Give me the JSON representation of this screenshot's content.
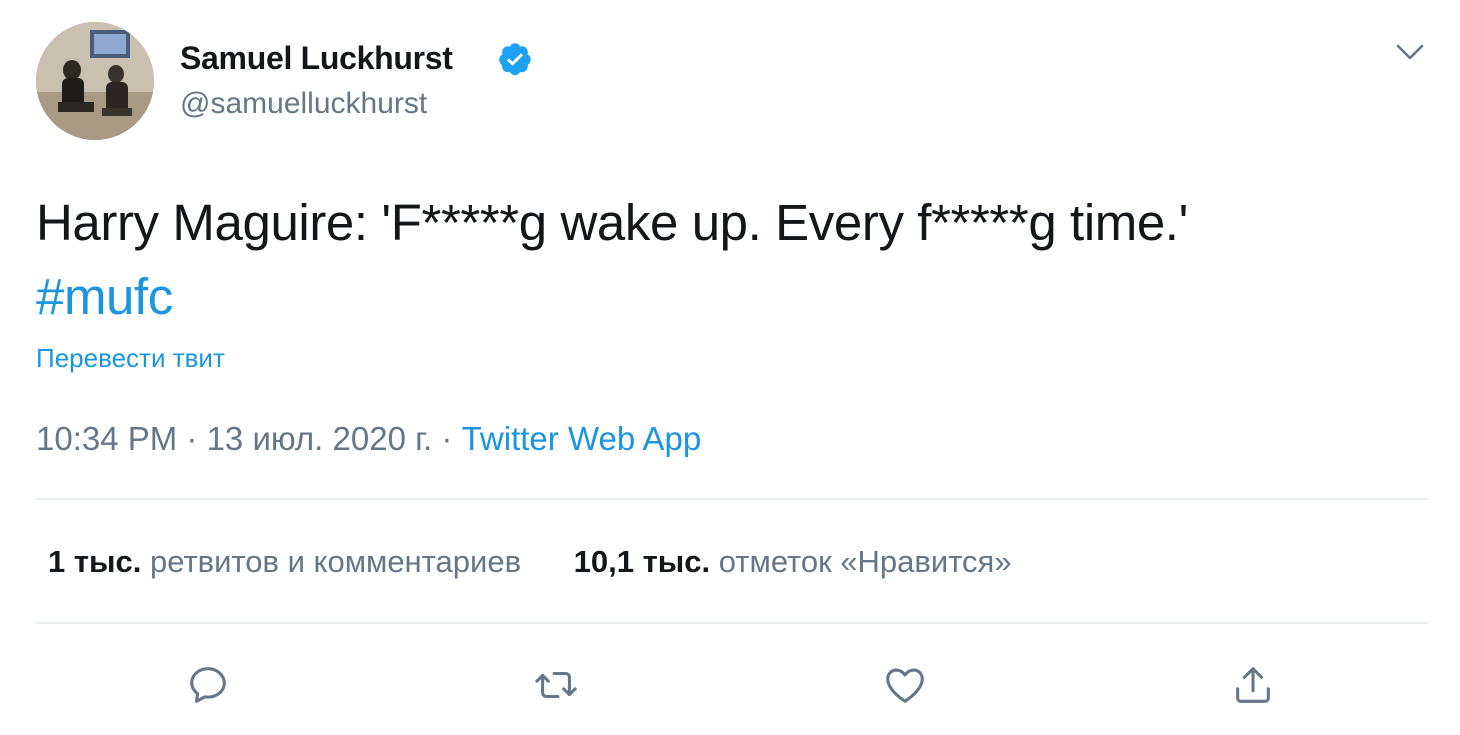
{
  "author": {
    "name": "Samuel Luckhurst",
    "handle": "@samuelluckhurst",
    "verified": true
  },
  "tweet": {
    "text": "Harry Maguire: 'F*****g wake up. Every f*****g time.'",
    "hashtag": "#mufc",
    "translate_label": "Перевести твит"
  },
  "meta": {
    "time": "10:34 PM",
    "separator": " · ",
    "date": "13 июл. 2020 г.",
    "source": "Twitter Web App"
  },
  "stats": {
    "retweets": {
      "count": "1 тыс.",
      "label": "ретвитов и комментариев"
    },
    "likes": {
      "count": "10,1 тыс.",
      "label": "отметок «Нравится»"
    }
  },
  "actions": [
    "reply-icon",
    "retweet-icon",
    "like-icon",
    "share-icon"
  ],
  "colors": {
    "link": "#1b95e0",
    "secondary_text": "#657786",
    "primary_text": "#14171a",
    "verified": "#1da1f2",
    "divider": "#e6ecf0"
  }
}
